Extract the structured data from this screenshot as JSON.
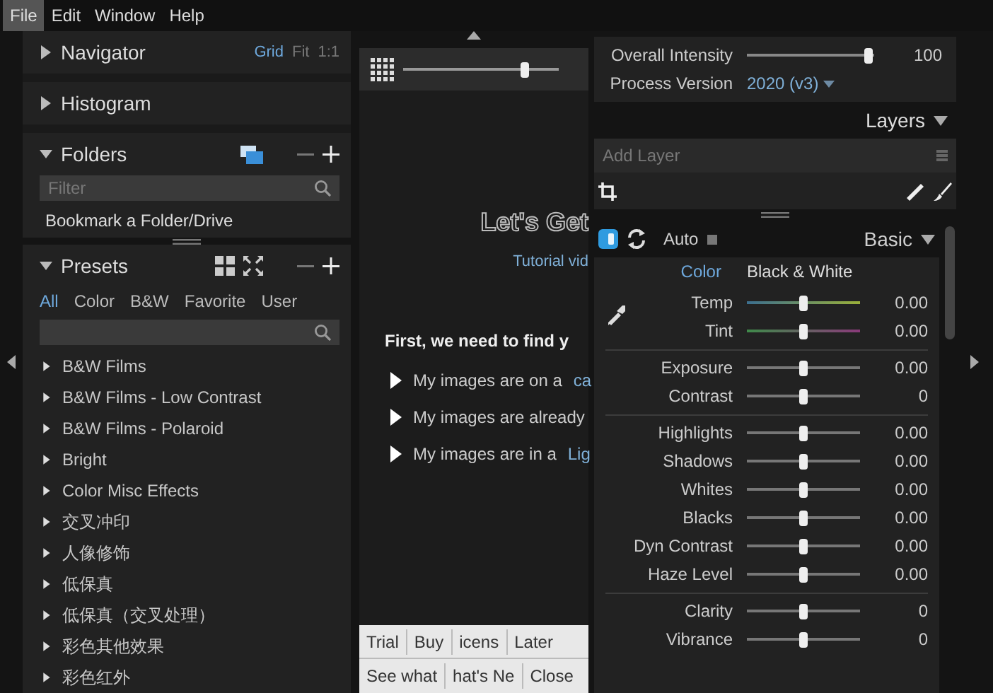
{
  "menu": [
    {
      "label": "File",
      "selected": true
    },
    {
      "label": "Edit",
      "selected": false
    },
    {
      "label": "Window",
      "selected": false
    },
    {
      "label": "Help",
      "selected": false
    }
  ],
  "navigator": {
    "title": "Navigator",
    "expanded": false,
    "modes": [
      {
        "label": "Grid",
        "selected": true
      },
      {
        "label": "Fit",
        "selected": false
      },
      {
        "label": "1:1",
        "selected": false
      }
    ]
  },
  "histogram": {
    "title": "Histogram",
    "expanded": false
  },
  "folders": {
    "title": "Folders",
    "expanded": true,
    "filter_placeholder": "Filter",
    "bookmark": "Bookmark a Folder/Drive"
  },
  "presets": {
    "title": "Presets",
    "expanded": true,
    "tabs": [
      {
        "label": "All",
        "selected": true
      },
      {
        "label": "Color",
        "selected": false
      },
      {
        "label": "B&W",
        "selected": false
      },
      {
        "label": "Favorite",
        "selected": false
      },
      {
        "label": "User",
        "selected": false
      }
    ],
    "items": [
      {
        "label": "B&W Films",
        "expanded": false
      },
      {
        "label": "B&W Films - Low Contrast",
        "expanded": false
      },
      {
        "label": "B&W Films - Polaroid",
        "expanded": false
      },
      {
        "label": "Bright",
        "expanded": false
      },
      {
        "label": "Color Misc Effects",
        "expanded": false
      },
      {
        "label": "交叉冲印",
        "expanded": false
      },
      {
        "label": "人像修饰",
        "expanded": false
      },
      {
        "label": "低保真",
        "expanded": false
      },
      {
        "label": "低保真（交叉处理）",
        "expanded": false
      },
      {
        "label": "彩色其他效果",
        "expanded": false
      },
      {
        "label": "彩色红外",
        "expanded": false
      }
    ]
  },
  "browser": {
    "thumb_size": {
      "level": 0.78
    },
    "heading": "Let's Get",
    "tutorial_link": "Tutorial vid",
    "prompt": "First, we need to find y",
    "options": [
      {
        "text": "My images are on a",
        "link": "ca"
      },
      {
        "text": "My images are already"
      },
      {
        "text": "My images are in a",
        "link": "Lig"
      }
    ],
    "trial_bar": {
      "row_1": [
        "Trial",
        "Buy",
        "icens",
        "Later"
      ],
      "row_2": [
        "See what",
        "hat's Ne",
        "Close"
      ]
    }
  },
  "edit": {
    "overall_intensity": {
      "label": "Overall Intensity",
      "level": 0.96,
      "reading": "100"
    },
    "process_version": {
      "label": "Process Version",
      "value": "2020 (v3)"
    },
    "layers": {
      "title": "Layers",
      "placeholder": "Add Layer"
    },
    "toolbar": {
      "before_after_on": true,
      "auto": "Auto",
      "panel": "Basic"
    },
    "treatment_tabs": [
      {
        "label": "Color",
        "selected": true
      },
      {
        "label": "Black & White",
        "selected": false
      }
    ],
    "slider_groups": [
      {
        "sliders": [
          {
            "label": "Temp",
            "kind": "temp",
            "level": 0.5,
            "reading": "0.00"
          },
          {
            "label": "Tint",
            "kind": "tint",
            "level": 0.5,
            "reading": "0.00"
          }
        ]
      },
      {
        "sliders": [
          {
            "label": "Exposure",
            "kind": "plain",
            "level": 0.5,
            "reading": "0.00"
          },
          {
            "label": "Contrast",
            "kind": "plain",
            "level": 0.5,
            "reading": "0"
          }
        ]
      },
      {
        "sliders": [
          {
            "label": "Highlights",
            "kind": "plain",
            "level": 0.5,
            "reading": "0.00"
          },
          {
            "label": "Shadows",
            "kind": "plain",
            "level": 0.5,
            "reading": "0.00"
          },
          {
            "label": "Whites",
            "kind": "plain",
            "level": 0.5,
            "reading": "0.00"
          },
          {
            "label": "Blacks",
            "kind": "plain",
            "level": 0.5,
            "reading": "0.00"
          },
          {
            "label": "Dyn Contrast",
            "kind": "plain",
            "level": 0.5,
            "reading": "0.00"
          },
          {
            "label": "Haze Level",
            "kind": "plain",
            "level": 0.5,
            "reading": "0.00"
          }
        ]
      },
      {
        "sliders": [
          {
            "label": "Clarity",
            "kind": "plain",
            "level": 0.5,
            "reading": "0"
          },
          {
            "label": "Vibrance",
            "kind": "plain",
            "level": 0.5,
            "reading": "0"
          }
        ]
      }
    ]
  }
}
